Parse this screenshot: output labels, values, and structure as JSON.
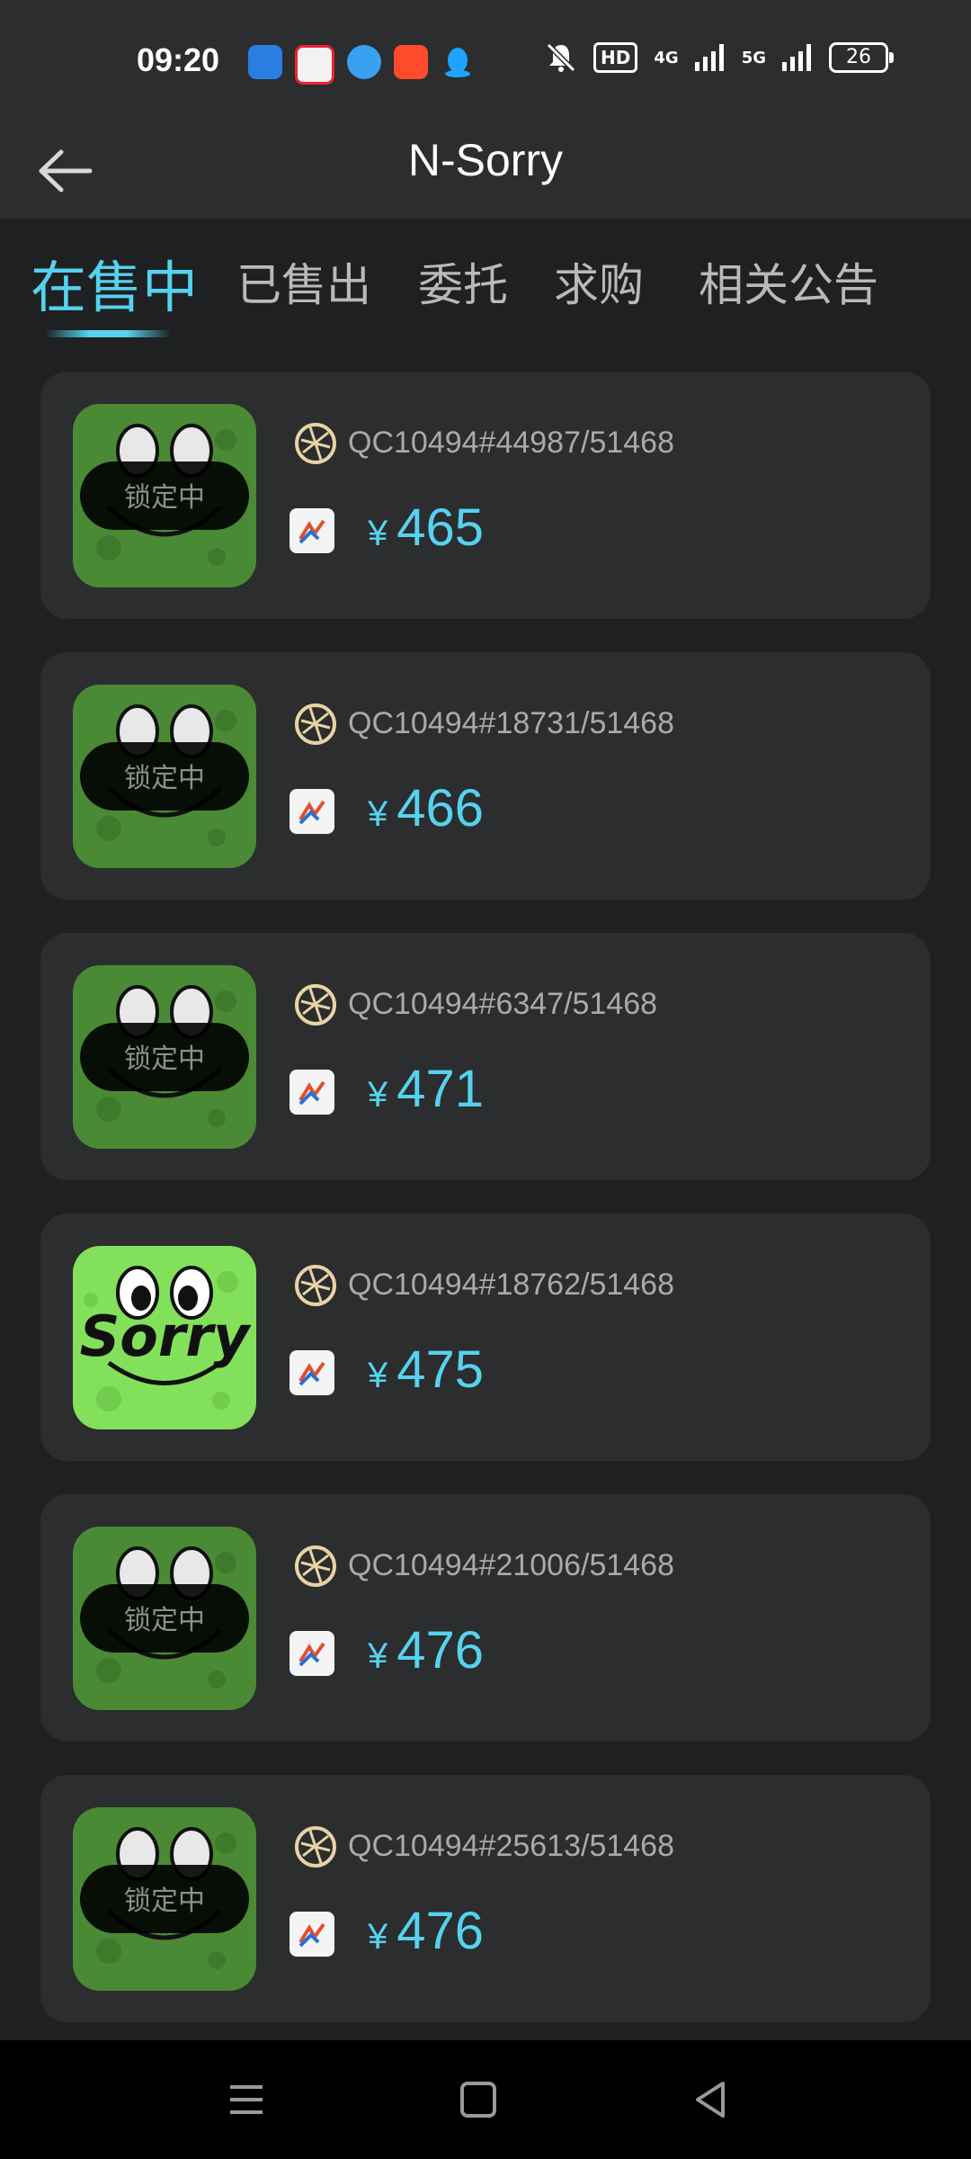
{
  "status_bar": {
    "time": "09:20",
    "network_badge": "HD",
    "signal1": "4G",
    "signal2": "5G",
    "battery": "26"
  },
  "header": {
    "title": "N-Sorry"
  },
  "tabs": [
    {
      "label": "在售中",
      "active": true
    },
    {
      "label": "已售出",
      "active": false
    },
    {
      "label": "委托",
      "active": false
    },
    {
      "label": "求购",
      "active": false
    },
    {
      "label": "相关公告",
      "active": false
    }
  ],
  "listings": [
    {
      "code": "QC10494#44987/51468",
      "currency": "¥",
      "price": "465",
      "locked": true,
      "lock_label": "锁定中"
    },
    {
      "code": "QC10494#18731/51468",
      "currency": "¥",
      "price": "466",
      "locked": true,
      "lock_label": "锁定中"
    },
    {
      "code": "QC10494#6347/51468",
      "currency": "¥",
      "price": "471",
      "locked": true,
      "lock_label": "锁定中"
    },
    {
      "code": "QC10494#18762/51468",
      "currency": "¥",
      "price": "475",
      "locked": false,
      "artwork_text": "Sorry"
    },
    {
      "code": "QC10494#21006/51468",
      "currency": "¥",
      "price": "476",
      "locked": true,
      "lock_label": "锁定中"
    },
    {
      "code": "QC10494#25613/51468",
      "currency": "¥",
      "price": "476",
      "locked": true,
      "lock_label": "锁定中"
    }
  ],
  "colors": {
    "accent": "#56d2ee",
    "card_bg": "#2b2d2e",
    "page_bg": "#1e2021",
    "artwork_green": "#83e05b",
    "artwork_green_dim": "#4a8a35"
  },
  "nav": {
    "icons": [
      "menu-icon",
      "home-icon",
      "back-triangle-icon"
    ]
  }
}
